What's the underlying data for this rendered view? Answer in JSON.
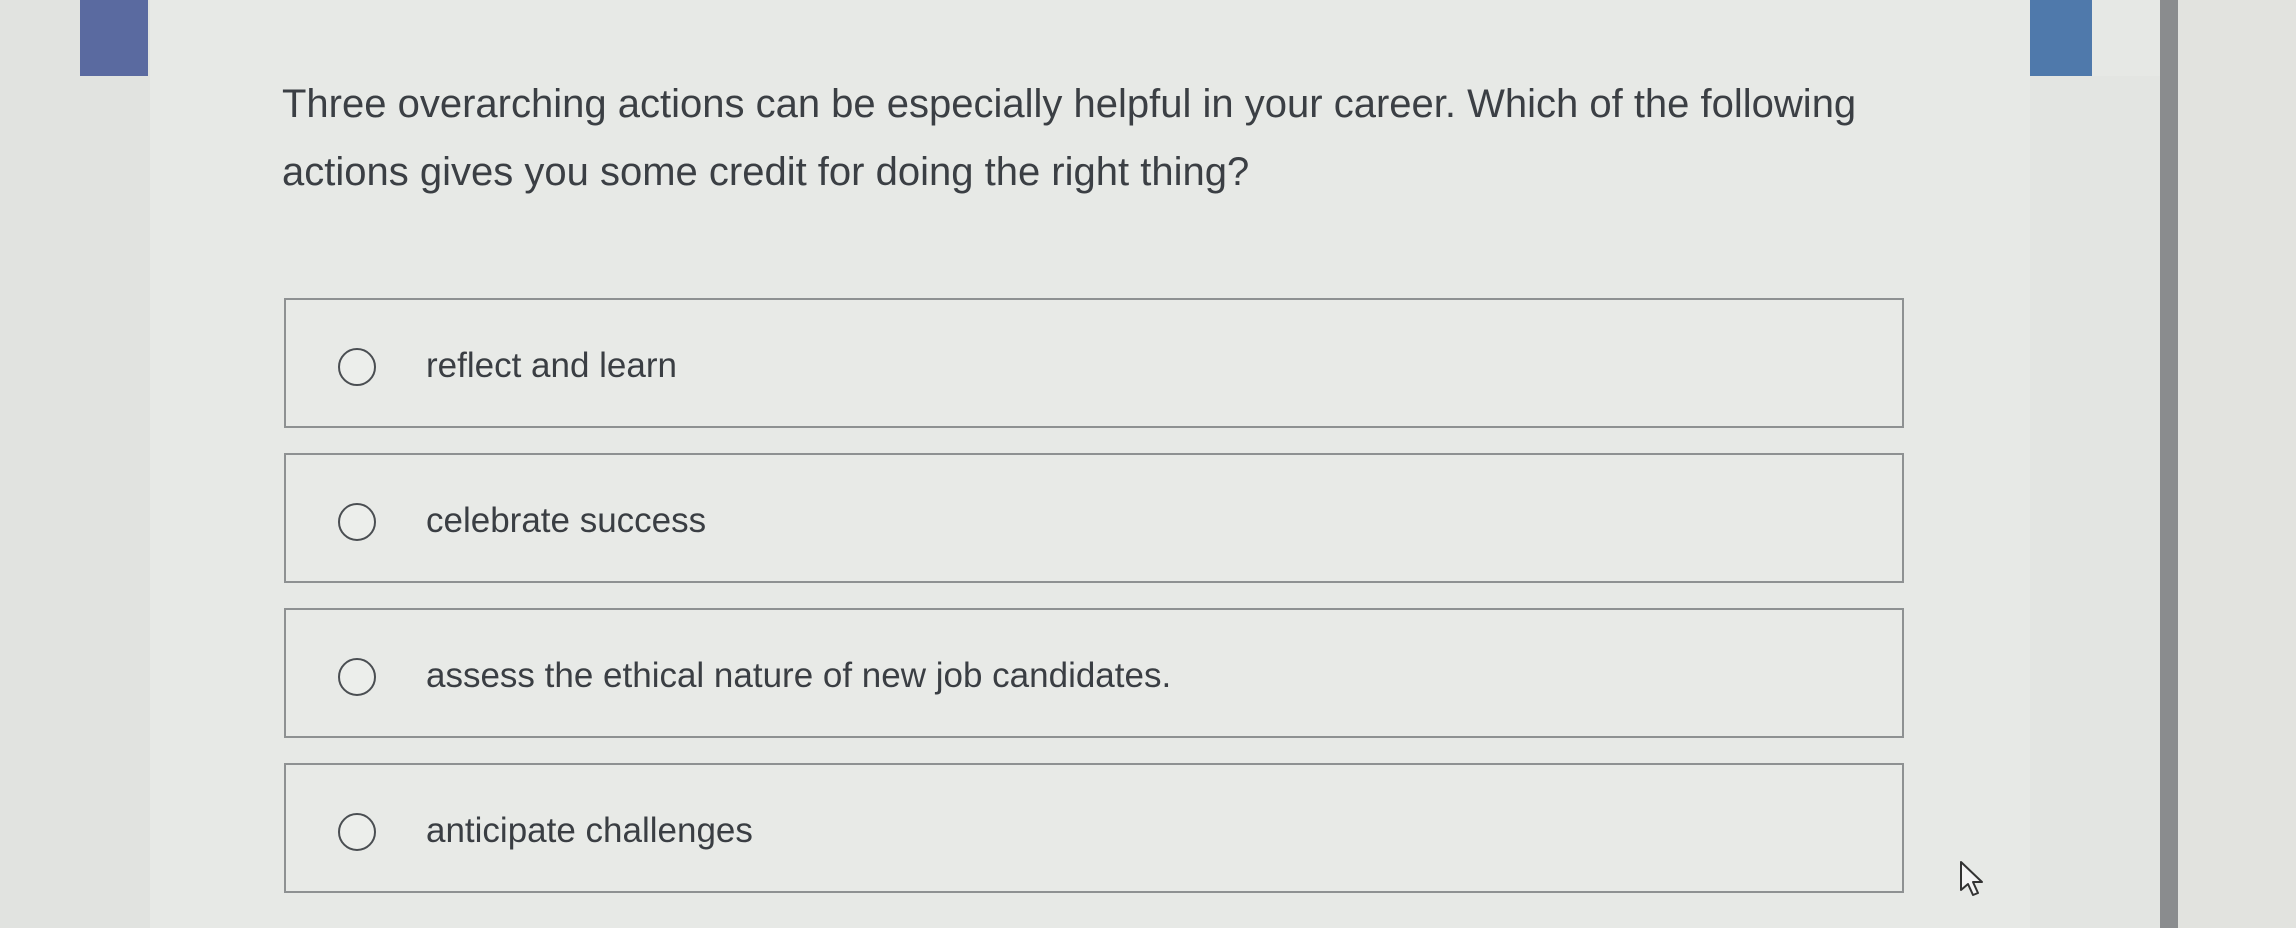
{
  "question": {
    "text": "Three overarching actions can be especially helpful in your career. Which of the following actions gives you some credit for doing the right thing?"
  },
  "options": [
    {
      "label": "reflect and learn",
      "selected": false
    },
    {
      "label": "celebrate success",
      "selected": false
    },
    {
      "label": "assess the ethical nature of new job candidates.",
      "selected": false
    },
    {
      "label": "anticipate challenges",
      "selected": false
    }
  ],
  "colors": {
    "left_tab": "#5a6aa0",
    "right_tab": "#4f79ab",
    "text": "#3b3f44",
    "border": "#8e9192"
  },
  "icons": {
    "radio": "radio-button-icon",
    "pointer": "mouse-pointer-icon"
  }
}
